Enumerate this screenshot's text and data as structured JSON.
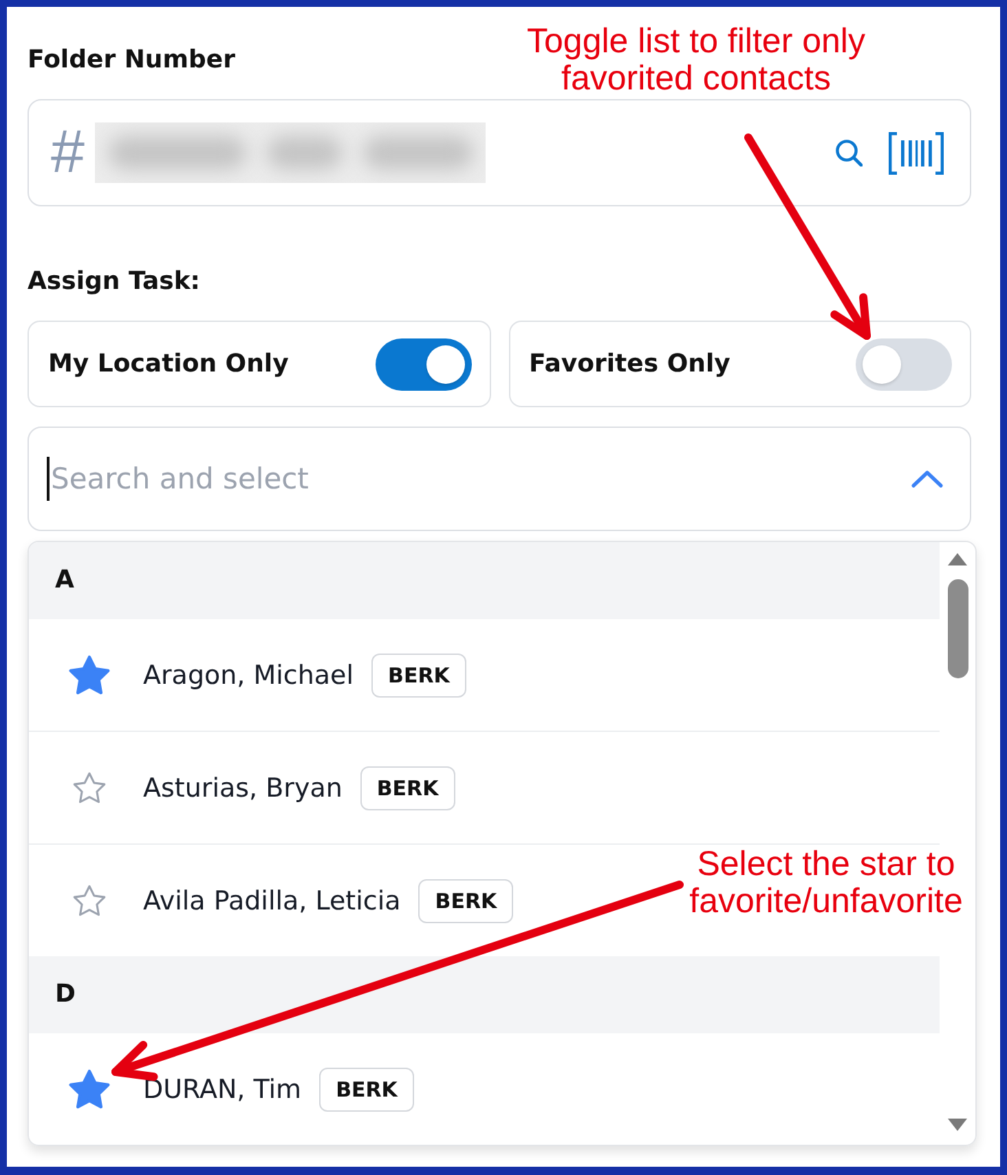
{
  "folder_number": {
    "label": "Folder Number",
    "prefix": "#",
    "value_blurred": true
  },
  "assign_task": {
    "label": "Assign Task:",
    "filters": [
      {
        "label": "My Location Only",
        "on": true
      },
      {
        "label": "Favorites Only",
        "on": false
      }
    ]
  },
  "search": {
    "placeholder": "Search and select",
    "focused": true,
    "expanded": true
  },
  "contacts": {
    "groups": [
      {
        "letter": "A",
        "items": [
          {
            "name": "Aragon, Michael",
            "badge": "BERK",
            "favorite": true
          },
          {
            "name": "Asturias, Bryan",
            "badge": "BERK",
            "favorite": false
          },
          {
            "name": "Avila Padilla, Leticia",
            "badge": "BERK",
            "favorite": false
          }
        ]
      },
      {
        "letter": "D",
        "items": [
          {
            "name": "DURAN, Tim",
            "badge": "BERK",
            "favorite": true
          }
        ]
      }
    ]
  },
  "annotations": [
    {
      "text": "Toggle list to filter only favorited contacts"
    },
    {
      "text": "Select the star to favorite/unfavorite"
    }
  ]
}
